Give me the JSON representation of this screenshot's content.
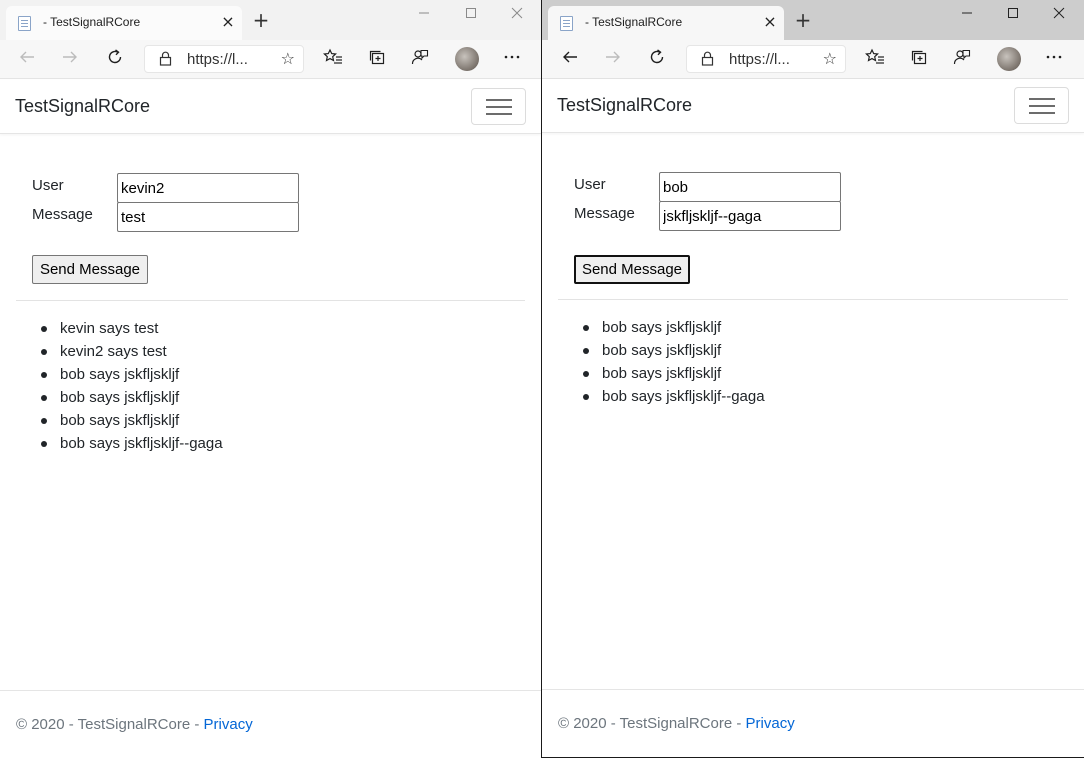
{
  "windows": [
    {
      "tab_title": "- TestSignalRCore",
      "tab_close": "×",
      "new_tab": "+",
      "address": "https://l...",
      "brand": "TestSignalRCore",
      "form": {
        "user_label": "User",
        "user_value": "kevin2",
        "message_label": "Message",
        "message_value": "test",
        "send_label": "Send Message"
      },
      "messages": [
        "kevin says test",
        "kevin2 says test",
        "bob says jskfljskljf",
        "bob says jskfljskljf",
        "bob says jskfljskljf",
        "bob says jskfljskljf--gaga"
      ],
      "footer": {
        "copyright": "© 2020 - TestSignalRCore - ",
        "privacy_link": "Privacy"
      }
    },
    {
      "tab_title": "- TestSignalRCore",
      "tab_close": "×",
      "new_tab": "+",
      "address": "https://l...",
      "brand": "TestSignalRCore",
      "form": {
        "user_label": "User",
        "user_value": "bob",
        "message_label": "Message",
        "message_value": "jskfljskljf--gaga",
        "send_label": "Send Message"
      },
      "messages": [
        "bob says jskfljskljf",
        "bob says jskfljskljf",
        "bob says jskfljskljf",
        "bob says jskfljskljf--gaga"
      ],
      "footer": {
        "copyright": "© 2020 - TestSignalRCore - ",
        "privacy_link": "Privacy"
      }
    }
  ],
  "icons": {
    "minimize": "minimize-icon",
    "maximize": "maximize-icon",
    "close": "close-icon",
    "back": "back-arrow-icon",
    "forward": "forward-arrow-icon",
    "refresh": "refresh-icon",
    "lock": "lock-icon",
    "favorite": "star-icon",
    "favorites": "favorites-icon",
    "collections": "collections-icon",
    "feedback": "feedback-icon",
    "more": "more-icon"
  },
  "colors": {
    "link": "#0366d6",
    "footer_text": "#6c757d",
    "text": "#212529"
  }
}
